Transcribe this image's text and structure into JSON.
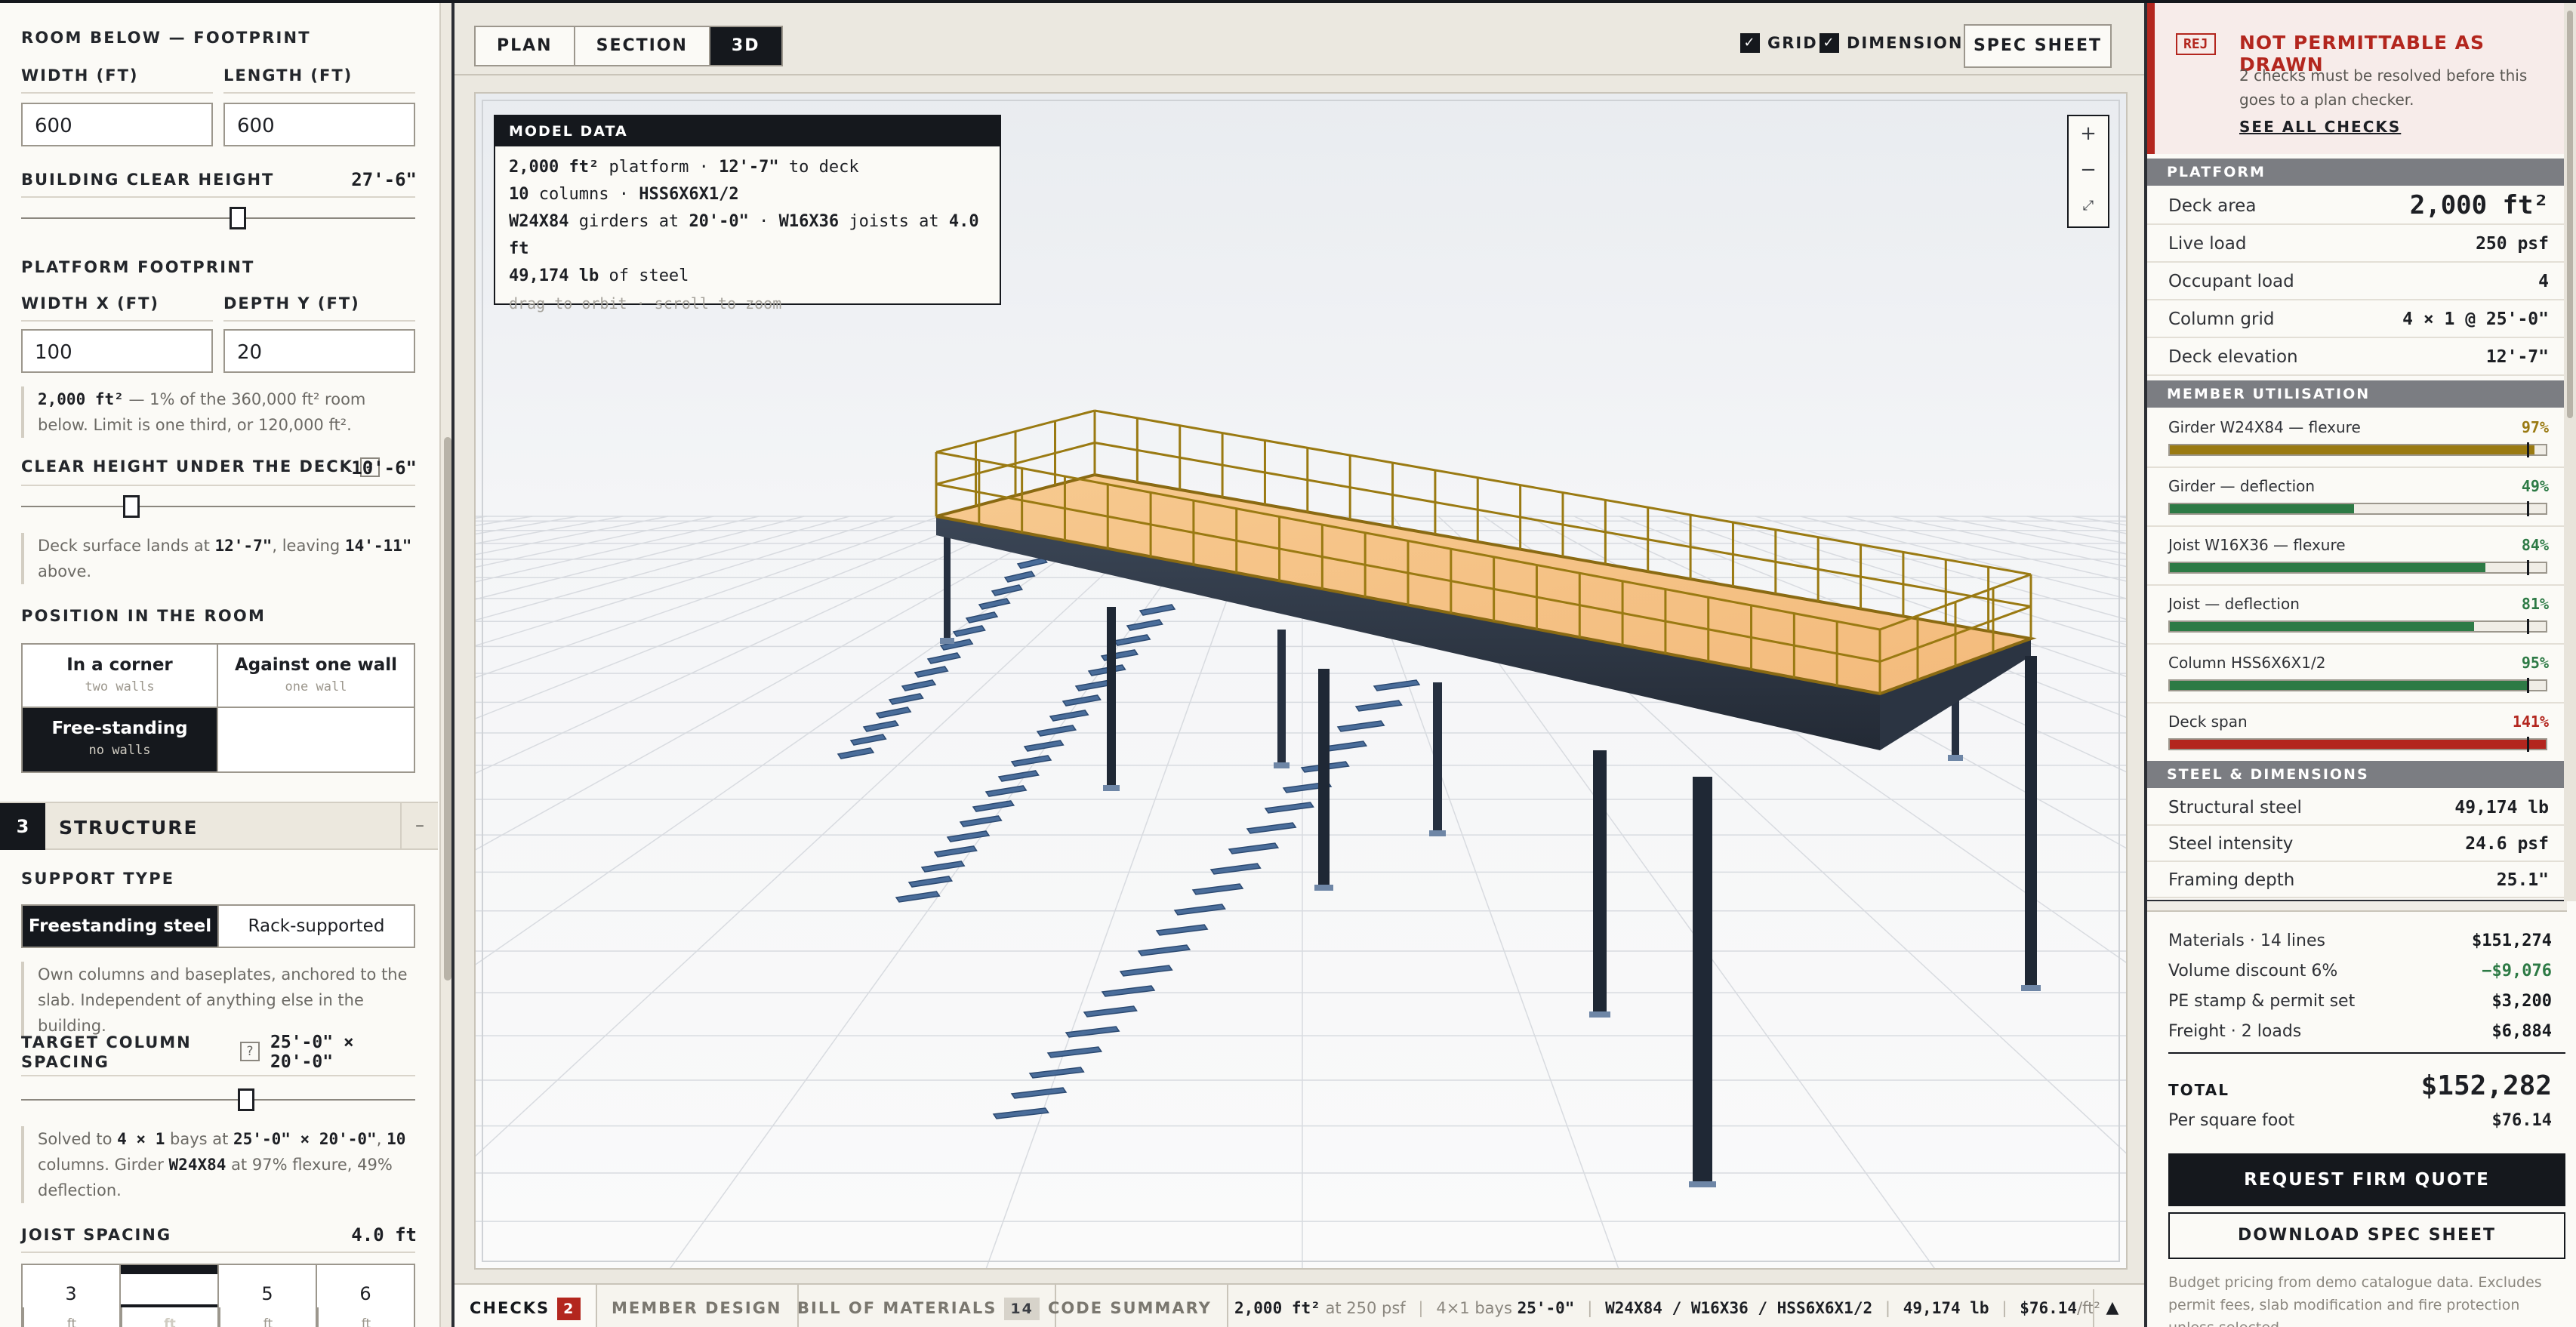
{
  "left": {
    "room_below": {
      "section": "ROOM BELOW — FOOTPRINT",
      "width_label": "WIDTH (FT)",
      "width_value": "600",
      "length_label": "LENGTH (FT)",
      "length_value": "600",
      "clear_height_label": "BUILDING CLEAR HEIGHT",
      "clear_height_value": "27'-6\"",
      "clear_height_slider": 0.55
    },
    "platform": {
      "section": "PLATFORM FOOTPRINT",
      "width_label": "WIDTH X (FT)",
      "width_value": "100",
      "depth_label": "DEPTH Y (FT)",
      "depth_value": "20",
      "note_area": "2,000 ft²",
      "note_text": " — 1% of the 360,000 ft² room below. Limit is one third, or 120,000 ft².",
      "deck_height_label": "CLEAR HEIGHT UNDER THE DECK",
      "help": "?",
      "deck_height_value": "10'-6\"",
      "deck_height_slider": 0.28,
      "deck_note_1": "Deck surface lands at ",
      "deck_note_elev": "12'-7\"",
      "deck_note_2": ", leaving ",
      "deck_note_left": "14'-11\"",
      "deck_note_3": " above."
    },
    "position": {
      "section": "POSITION IN THE ROOM",
      "options": [
        {
          "title": "In a corner",
          "sub": "two walls"
        },
        {
          "title": "Against one wall",
          "sub": "one wall"
        },
        {
          "title": "Free-standing",
          "sub": "no walls"
        },
        {
          "title": "",
          "sub": ""
        }
      ]
    },
    "structure": {
      "number": "3",
      "title": "STRUCTURE",
      "collapse": "–",
      "support_label": "SUPPORT TYPE",
      "support_options": [
        "Freestanding steel",
        "Rack-supported"
      ],
      "support_note": "Own columns and baseplates, anchored to the slab. Independent of anything else in the building.",
      "spacing_label": "TARGET COLUMN SPACING",
      "spacing_value": "25'-0\" × 20'-0\"",
      "spacing_slider": 0.57,
      "solve_1": "Solved to ",
      "solve_bays": "4 × 1",
      "solve_2": " bays at ",
      "solve_dims": "25'-0\" × 20'-0\"",
      "solve_3": ", ",
      "solve_cols": "10",
      "solve_4": " columns. Girder ",
      "solve_girder": "W24X84",
      "solve_5": " at 97% flexure, 49% deflection.",
      "joist_label": "JOIST SPACING",
      "joist_value": "4.0 ft",
      "joist_options": [
        {
          "n": "3",
          "u": "ft"
        },
        {
          "n": "4",
          "u": "ft"
        },
        {
          "n": "5",
          "u": "ft"
        },
        {
          "n": "6",
          "u": "ft"
        }
      ]
    }
  },
  "center": {
    "view_tabs": [
      "PLAN",
      "SECTION",
      "3D"
    ],
    "grid_label": "GRID",
    "dim_label": "DIMENSIONS",
    "spec_button": "SPEC SHEET",
    "model": {
      "header": "MODEL DATA",
      "l1a": "2,000 ft²",
      "l1b": " platform · ",
      "l1c": "12'-7\"",
      "l1d": " to deck",
      "l2a": "10",
      "l2b": " columns · ",
      "l2c": "HSS6X6X1/2",
      "l3a": "W24X84",
      "l3b": " girders at ",
      "l3c": "20'-0\"",
      "l3d": " · ",
      "l3e": "W16X36",
      "l3f": " joists at ",
      "l3g": "4.0 ft",
      "l4a": "49,174 lb",
      "l4b": " of steel",
      "hint": "drag to orbit · scroll to zoom"
    },
    "zoom": [
      "+",
      "−",
      "⤢"
    ],
    "bottom": {
      "tabs": [
        {
          "label": "CHECKS",
          "badge": "2"
        },
        {
          "label": "MEMBER DESIGN",
          "badge": ""
        },
        {
          "label": "BILL OF MATERIALS",
          "badge": "14"
        },
        {
          "label": "CODE SUMMARY",
          "badge": ""
        }
      ],
      "s_area": "2,000 ft²",
      "s_load": " at 250 psf",
      "s_bays": "4×1 bays ",
      "s_span": "25'-0\"",
      "s_members": "W24X84 / W16X36 / HSS6X6X1/2",
      "s_steel": "49,174 lb",
      "s_cost": "$76.14",
      "s_cost_unit": "/ft²",
      "toggle": "▲"
    }
  },
  "right": {
    "alert": {
      "tag": "REJ",
      "title": "NOT PERMITTABLE AS DRAWN",
      "message": "2 checks must be resolved before this goes to a plan checker.",
      "link": "SEE ALL CHECKS"
    },
    "platform_section": "PLATFORM",
    "platform_rows": [
      {
        "k": "Deck area",
        "v": "2,000 ft²"
      },
      {
        "k": "Live load",
        "v": "250 psf"
      },
      {
        "k": "Occupant load",
        "v": "4"
      },
      {
        "k": "Column grid",
        "v": "4 × 1 @ 25'-0\""
      },
      {
        "k": "Deck elevation",
        "v": "12'-7\""
      }
    ],
    "util_section": "MEMBER UTILISATION",
    "utilisation": [
      {
        "k": "Girder W24X84 — flexure",
        "v": "97%",
        "pct": 97,
        "color": "#9a7a12"
      },
      {
        "k": "Girder — deflection",
        "v": "49%",
        "pct": 49,
        "color": "#2d7a45"
      },
      {
        "k": "Joist W16X36 — flexure",
        "v": "84%",
        "pct": 84,
        "color": "#2d7a45"
      },
      {
        "k": "Joist — deflection",
        "v": "81%",
        "pct": 81,
        "color": "#2d7a45"
      },
      {
        "k": "Column HSS6X6X1/2",
        "v": "95%",
        "pct": 95,
        "color": "#2d7a45"
      },
      {
        "k": "Deck span",
        "v": "141%",
        "pct": 141,
        "color": "#b3261e"
      }
    ],
    "steel_section": "STEEL & DIMENSIONS",
    "steel_rows": [
      {
        "k": "Structural steel",
        "v": "49,174 lb"
      },
      {
        "k": "Steel intensity",
        "v": "24.6 psf"
      },
      {
        "k": "Framing depth",
        "v": "25.1\""
      }
    ],
    "costs": [
      {
        "k": "Materials · 14 lines",
        "v": "$151,274",
        "color": "#15181d"
      },
      {
        "k": "Volume discount 6%",
        "v": "−$9,076",
        "color": "#2d7a45"
      },
      {
        "k": "PE stamp & permit set",
        "v": "$3,200",
        "color": "#15181d"
      },
      {
        "k": "Freight · 2 loads",
        "v": "$6,884",
        "color": "#15181d"
      }
    ],
    "total_label": "TOTAL",
    "total_value": "$152,282",
    "psf_label": "Per square foot",
    "psf_value": "$76.14",
    "quote_button": "REQUEST FIRM QUOTE",
    "download_button": "DOWNLOAD SPEC SHEET",
    "fine_print": "Budget pricing from demo catalogue data. Excludes permit fees, slab modification and fire protection unless selected."
  }
}
